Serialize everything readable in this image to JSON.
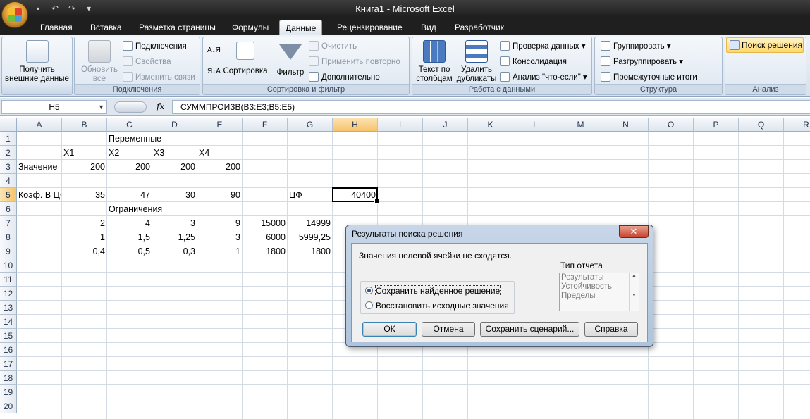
{
  "window": {
    "title": "Книга1 - Microsoft Excel"
  },
  "tabs": [
    "Главная",
    "Вставка",
    "Разметка страницы",
    "Формулы",
    "Данные",
    "Рецензирование",
    "Вид",
    "Разработчик"
  ],
  "active_tab": "Данные",
  "ribbon": {
    "get_external": "Получить внешние данные",
    "get_external_l1": "Получить",
    "get_external_l2": "внешние данные",
    "connections_group": "Подключения",
    "refresh_l1": "Обновить",
    "refresh_l2": "все",
    "connections": "Подключения",
    "properties": "Свойства",
    "edit_links": "Изменить связи",
    "sort_filter_group": "Сортировка и фильтр",
    "sort": "Сортировка",
    "filter": "Фильтр",
    "clear": "Очистить",
    "reapply": "Применить повторно",
    "advanced": "Дополнительно",
    "data_tools_group": "Работа с данными",
    "text_to_cols_l1": "Текст по",
    "text_to_cols_l2": "столбцам",
    "remove_dups_l1": "Удалить",
    "remove_dups_l2": "дубликаты",
    "validation": "Проверка данных",
    "consolidate": "Консолидация",
    "whatif": "Анализ \"что-если\"",
    "outline_group": "Структура",
    "group": "Группировать",
    "ungroup": "Разгруппировать",
    "subtotal": "Промежуточные итоги",
    "analysis_group": "Анализ",
    "solver": "Поиск решения"
  },
  "formula_bar": {
    "name_box": "H5",
    "fx": "fx",
    "formula": "=СУММПРОИЗВ(B3:E3;B5:E5)"
  },
  "columns": [
    "A",
    "B",
    "C",
    "D",
    "E",
    "F",
    "G",
    "H",
    "I",
    "J",
    "K",
    "L",
    "M",
    "N",
    "O",
    "P",
    "Q",
    "R"
  ],
  "rows": [
    "1",
    "2",
    "3",
    "4",
    "5",
    "6",
    "7",
    "8",
    "9",
    "10",
    "11",
    "12",
    "13",
    "14",
    "15",
    "16",
    "17",
    "18",
    "19",
    "20"
  ],
  "cells": {
    "C1": "Переменные",
    "B2": "X1",
    "C2": "X2",
    "D2": "X3",
    "E2": "X4",
    "A3": "Значение",
    "B3": "200",
    "C3": "200",
    "D3": "200",
    "E3": "200",
    "A5": "Коэф. В ЦФ",
    "B5": "35",
    "C5": "47",
    "D5": "30",
    "E5": "90",
    "G5": "ЦФ",
    "H5": "40400",
    "C6": "Ограничения",
    "B7": "2",
    "C7": "4",
    "D7": "3",
    "E7": "9",
    "F7": "15000",
    "G7": "14999",
    "B8": "1",
    "C8": "1,5",
    "D8": "1,25",
    "E8": "3",
    "F8": "6000",
    "G8": "5999,25",
    "B9": "0,4",
    "C9": "0,5",
    "D9": "0,3",
    "E9": "1",
    "F9": "1800",
    "G9": "1800"
  },
  "dialog": {
    "title": "Результаты поиска решения",
    "close": "✕",
    "message": "Значения целевой ячейки не сходятся.",
    "report_type_label": "Тип отчета",
    "reports": [
      "Результаты",
      "Устойчивость",
      "Пределы"
    ],
    "keep_solution": "Сохранить найденное решение",
    "restore_values": "Восстановить исходные значения",
    "ok": "ОК",
    "cancel": "Отмена",
    "save_scenario": "Сохранить сценарий...",
    "help": "Справка"
  }
}
